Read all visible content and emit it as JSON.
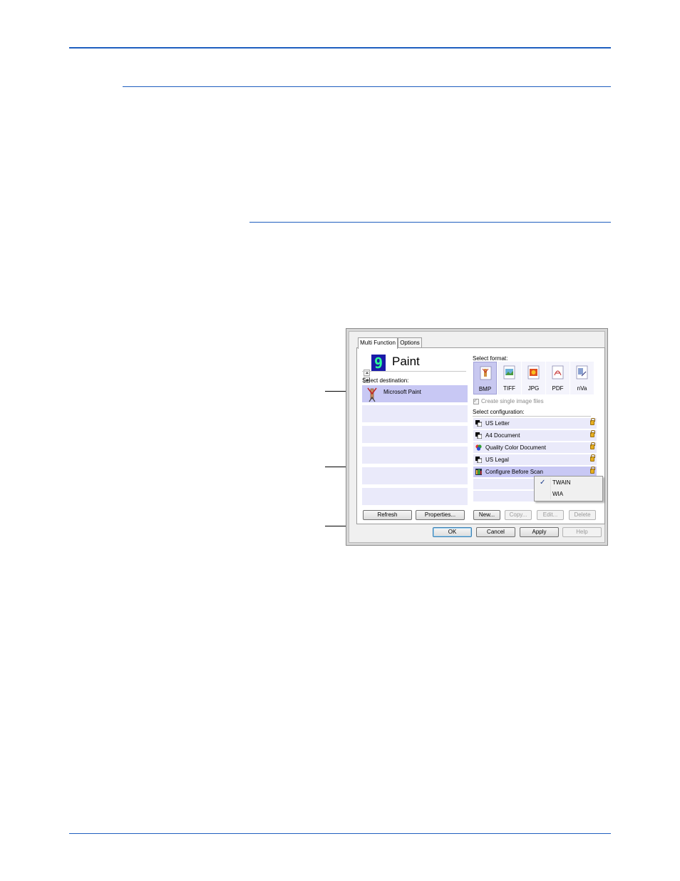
{
  "dialog": {
    "tabs": {
      "multi_function": "Multi Function",
      "options": "Options"
    },
    "selected_app": {
      "digit": "9",
      "name": "Paint"
    },
    "destination_label": "Select destination:",
    "destinations": [
      "Microsoft Paint"
    ],
    "format_label": "Select format:",
    "formats": [
      "BMP",
      "TIFF",
      "JPG",
      "PDF",
      "nVa"
    ],
    "selected_format": "BMP",
    "single_image_label": "Create single image files",
    "configuration_label": "Select configuration:",
    "configurations": [
      "US Letter",
      "A4 Document",
      "Quality Color Document",
      "US Legal",
      "Configure Before Scan"
    ],
    "selected_configuration": "Configure Before Scan",
    "popup_menu": {
      "items": [
        "TWAIN",
        "WIA"
      ],
      "checked": "TWAIN"
    },
    "buttons": {
      "refresh": "Refresh",
      "properties": "Properties...",
      "new": "New...",
      "copy": "Copy...",
      "edit": "Edit...",
      "delete": "Delete",
      "ok": "OK",
      "cancel": "Cancel",
      "apply": "Apply",
      "help": "Help"
    }
  },
  "colors": {
    "rule": "#1f5fbf",
    "row": "#eaeafa",
    "selected_row": "#c8c8f4"
  },
  "icons": [
    "paint-app-icon",
    "bmp-format-icon",
    "tiff-format-icon",
    "jpg-format-icon",
    "pdf-format-icon",
    "nva-format-icon",
    "lock-icon",
    "check-icon"
  ]
}
